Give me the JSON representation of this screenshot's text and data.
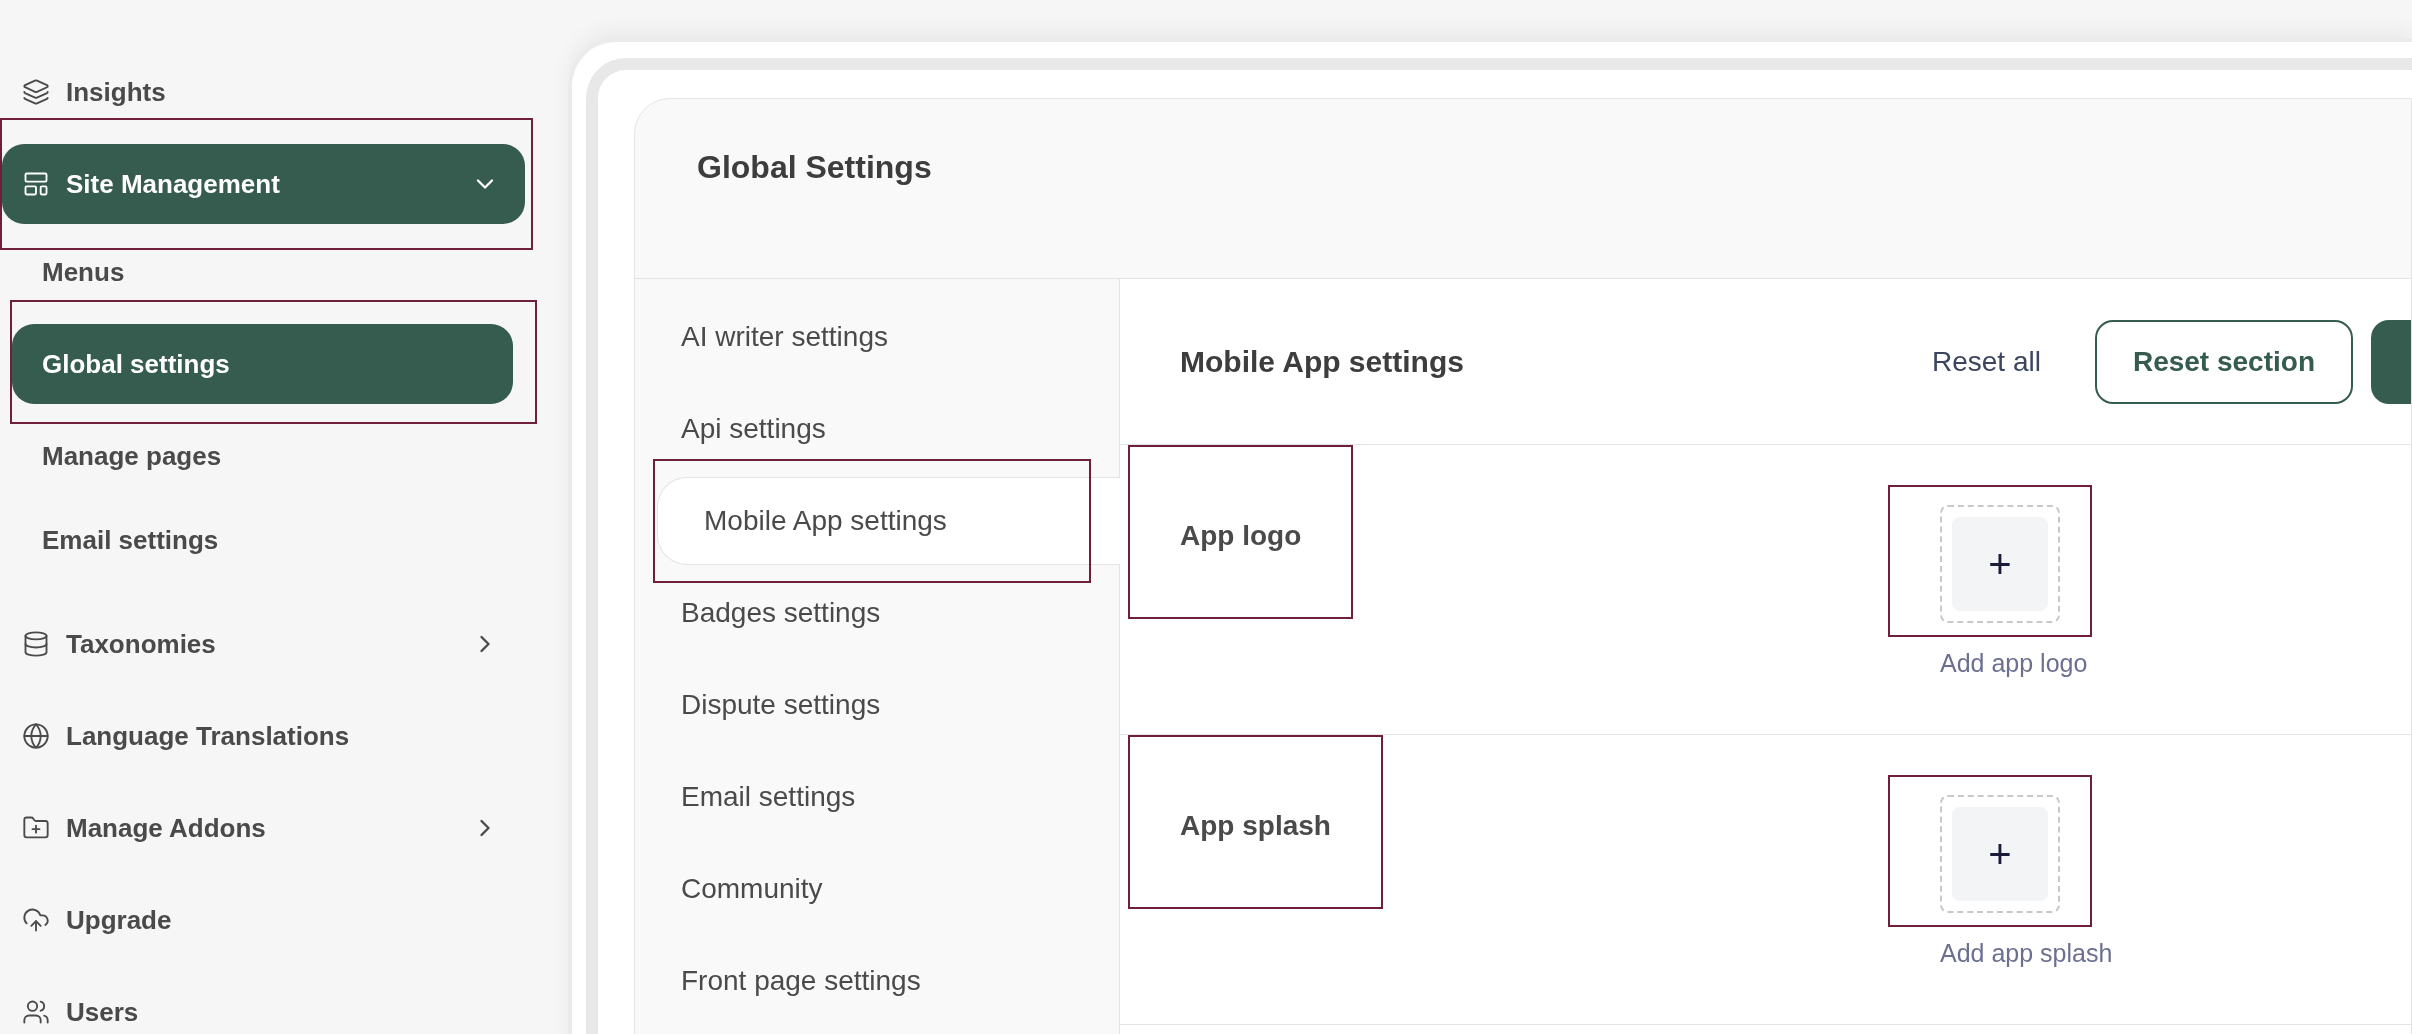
{
  "sidebar": {
    "items": [
      {
        "label": "Insights",
        "kind": "link",
        "expanded": false,
        "highlighted": false
      },
      {
        "label": "Site Management",
        "kind": "group",
        "expanded": true,
        "highlighted": true,
        "children": [
          {
            "label": "Menus",
            "selected": false,
            "highlighted": false
          },
          {
            "label": "Global settings",
            "selected": true,
            "highlighted": true
          },
          {
            "label": "Manage pages",
            "selected": false,
            "highlighted": false
          },
          {
            "label": "Email settings",
            "selected": false,
            "highlighted": false
          }
        ]
      },
      {
        "label": "Taxonomies",
        "kind": "group",
        "expanded": false,
        "highlighted": false
      },
      {
        "label": "Language Translations",
        "kind": "link",
        "expanded": false,
        "highlighted": false
      },
      {
        "label": "Manage Addons",
        "kind": "group",
        "expanded": false,
        "highlighted": false
      },
      {
        "label": "Upgrade",
        "kind": "link",
        "expanded": false,
        "highlighted": false
      },
      {
        "label": "Users",
        "kind": "link",
        "expanded": false,
        "highlighted": false
      }
    ]
  },
  "page": {
    "title": "Global Settings"
  },
  "settings_nav": [
    {
      "label": "AI writer settings",
      "selected": false,
      "highlighted": false
    },
    {
      "label": "Api settings",
      "selected": false,
      "highlighted": false
    },
    {
      "label": "Mobile App settings",
      "selected": true,
      "highlighted": true
    },
    {
      "label": "Badges settings",
      "selected": false,
      "highlighted": false
    },
    {
      "label": "Dispute settings",
      "selected": false,
      "highlighted": false
    },
    {
      "label": "Email settings",
      "selected": false,
      "highlighted": false
    },
    {
      "label": "Community",
      "selected": false,
      "highlighted": false
    },
    {
      "label": "Front page settings",
      "selected": false,
      "highlighted": false
    }
  ],
  "section": {
    "title": "Mobile App settings",
    "reset_all": "Reset all",
    "reset_section": "Reset section",
    "fields": [
      {
        "label": "App logo",
        "caption": "Add app logo",
        "upload_symbol": "+",
        "label_highlighted": true,
        "upload_highlighted": true
      },
      {
        "label": "App splash",
        "caption": "Add app splash",
        "upload_symbol": "+",
        "label_highlighted": true,
        "upload_highlighted": true
      }
    ]
  }
}
